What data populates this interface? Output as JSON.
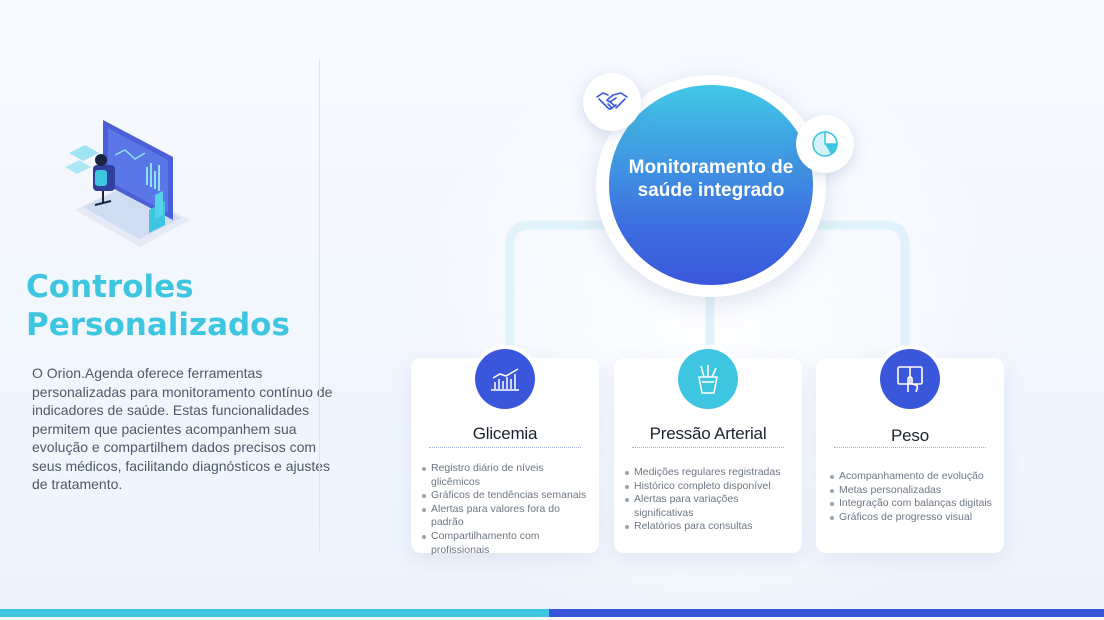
{
  "left": {
    "heading": "Controles Personalizados",
    "description": "O Orion.Agenda oferece ferramentas personalizadas para monitoramento contínuo de indicadores de saúde. Estas funcionalidades permitem que pacientes acompanhem sua evolução e compartilhem dados precisos com seus médicos, facilitando diagnósticos e ajustes de tratamento."
  },
  "hub": {
    "title": "Monitoramento de saúde integrado",
    "icons": [
      "handshake-icon",
      "pie-chart-icon"
    ]
  },
  "cards": [
    {
      "title": "Glicemia",
      "icon": "bar-chart-icon",
      "items": [
        "Registro diário de níveis glicêmicos",
        "Gráficos de tendências semanais",
        "Alertas para valores fora do padrão",
        "Compartilhamento com profissionais"
      ]
    },
    {
      "title": "Pressão Arterial",
      "icon": "pencil-cup-icon",
      "items": [
        "Medições regulares registradas",
        "Histórico completo disponível",
        "Alertas para variações significativas",
        "Relatórios para consultas"
      ]
    },
    {
      "title": "Peso",
      "icon": "touch-screen-icon",
      "items": [
        "Acompanhamento de evolução",
        "Metas personalizadas",
        "Integração com balanças digitais",
        "Gráficos de progresso visual"
      ]
    }
  ],
  "colors": {
    "accent_cyan": "#3ec6e0",
    "accent_blue": "#3a57db",
    "text": "#4d5a68"
  }
}
